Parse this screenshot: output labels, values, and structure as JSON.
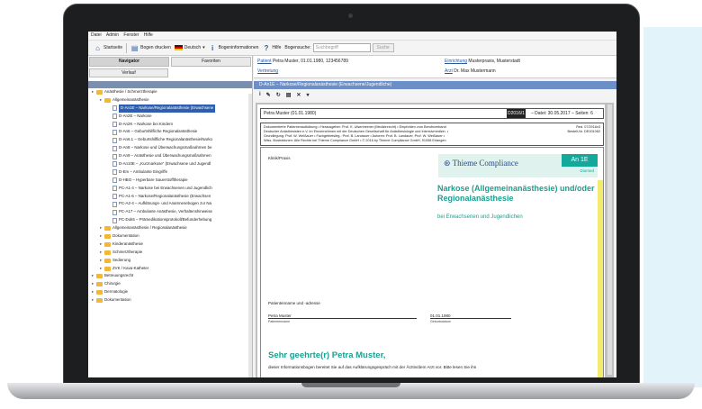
{
  "menubar": [
    "Datei",
    "Admin",
    "Fenster",
    "Hilfe"
  ],
  "toolbar": {
    "startseite": "Startseite",
    "bogen_drucken": "Bogen drucken",
    "sprache": "Deutsch",
    "bogeninfo": "Bogeninformationen",
    "hilfe": "Hilfe",
    "bogensuche_label": "Bogensuche:",
    "search_placeholder": "Suchbegriff",
    "go": "Suche"
  },
  "left": {
    "tabs": [
      "Navigator",
      "Favoriten"
    ],
    "tab2": "Verlauf",
    "tree": [
      {
        "text": "Anästhesie / Schmerztherapie",
        "type": "folder",
        "indent": 0
      },
      {
        "text": "Allgemeinanästhesie",
        "type": "folder",
        "indent": 1
      },
      {
        "text": "D-An1E – Narkose/Regionalanästhesie (Erwachsene",
        "type": "doc",
        "indent": 2,
        "selected": true
      },
      {
        "text": "D-An2E – Narkose",
        "type": "doc",
        "indent": 2
      },
      {
        "text": "D-An2K – Narkose bei Kindern",
        "type": "doc",
        "indent": 2
      },
      {
        "text": "D-An6 – Geburtshilfliche Regionalanästhesie",
        "type": "doc",
        "indent": 2
      },
      {
        "text": "D-An6.1 – Geburtshilfliche Regionalanästhesie/Narko",
        "type": "doc",
        "indent": 2
      },
      {
        "text": "D-An8 – Narkose und Überwachungsmaßnahmen be",
        "type": "doc",
        "indent": 2
      },
      {
        "text": "D-An9 – Anästhesie und Überwachungsmaßnahmen",
        "type": "doc",
        "indent": 2
      },
      {
        "text": "D-An10E – „Kurznarkose“ (Erwachsene und Jugendl",
        "type": "doc",
        "indent": 2
      },
      {
        "text": "D-Em – Ambulante Eingriffe",
        "type": "doc",
        "indent": 2
      },
      {
        "text": "D-HBO – Hyperbare Sauerstofftherapie",
        "type": "doc",
        "indent": 2
      },
      {
        "text": "PC-A1-4 – Narkose bei Erwachsenen und Jugendlich",
        "type": "doc",
        "indent": 2
      },
      {
        "text": "PC-A1-6 – Narkose/Regionalanästhesie (Erwachsen",
        "type": "doc",
        "indent": 2
      },
      {
        "text": "PC-A2-4 – Aufklärungs- und Anamnesebogen zur Na",
        "type": "doc",
        "indent": 2
      },
      {
        "text": "PC-A17 – Ambulante Anästhesie, Verhaltenshinweise",
        "type": "doc",
        "indent": 2
      },
      {
        "text": "PC-Dok5 – Prämedikationsprotokoll/Befunderhebung",
        "type": "doc",
        "indent": 2
      },
      {
        "text": "Allgemeinanästhesie / Regionalanästhesie",
        "type": "folder",
        "indent": 1
      },
      {
        "text": "Dokumentation",
        "type": "folder",
        "indent": 1
      },
      {
        "text": "Kinderanästhesie",
        "type": "folder",
        "indent": 1
      },
      {
        "text": "Schmerztherapie",
        "type": "folder",
        "indent": 1
      },
      {
        "text": "Sedierung",
        "type": "folder",
        "indent": 1
      },
      {
        "text": "ZVK / Kava-Katheter",
        "type": "folder",
        "indent": 1
      },
      {
        "text": "Betreuungsrecht",
        "type": "folder",
        "indent": 0
      },
      {
        "text": "Chirurgie",
        "type": "folder",
        "indent": 0
      },
      {
        "text": "Dermatologie",
        "type": "folder",
        "indent": 0
      },
      {
        "text": "Dokumentation",
        "type": "folder",
        "indent": 0
      }
    ]
  },
  "patient": {
    "label": "Patient",
    "value": "Petra Muster, 01.01.1980, 123456789",
    "einrichtung_label": "Einrichtung",
    "einrichtung_value": "Musterpraxis, Musterstadt",
    "vertretung_label": "Vertretung",
    "arzt_label": "Arzt",
    "arzt_value": "Dr. Max Mustermann"
  },
  "docbar": "D-An1E – Narkose/Regionalanästhesie (Erwachsene/Jugendliche)",
  "doc": {
    "patline_left": "Petra Muster (01.01.1980)",
    "patline_code": "D2016/1",
    "patline_right": "– Datei: 30.05.2017 – Seiten: 6",
    "box_lines": [
      "Dokumentierte Patientenaufklärung • Herausgeber: Prof. K. Ulsenheimer (Medizinrecht) • Empfohlen vom Berufsverband",
      "Deutscher Anästhesisten e.V. im Einvernehmen mit der Deutschen Gesellschaft für Anästhesiologie und Intensivmedizin. •",
      "Grundlegung: Prof. W. Weißauer • Fachgebietsltrg.: Prof. B. Landauer • Autoren: Prof. B. Landauer, Prof. W. Weißauer •",
      "Wiss. Illustrationen: Alle Rechte bei Thieme Compliance GmbH • © 2016 by Thieme Compliance GmbH, 91058 Erlangen"
    ],
    "red": "Red. 07/2016v3",
    "bestell": "Bestell-Nr. DE001062",
    "klinik": "Klinik/Praxis",
    "logo": "Thieme Compliance",
    "code": "An 1E",
    "diomed": "Diomed",
    "title_line1": "Narkose (Allgemeinanästhesie) und/oder",
    "title_line2": "Regionalanästhesie",
    "subtitle": "bei Erwachsenen und Jugendlichen",
    "patientenname_label": "Patientenname und -adresse",
    "name_value": "Petra Muster",
    "name_caption": "Patientenname",
    "dob_value": "01.01.1980",
    "dob_caption": "Geburtsdatum",
    "greeting": "Sehr geehrte(r) Petra Muster,",
    "body": "dieser Informationsbogen bereitet Sie auf das Aufklärungsgespräch mit der Ärztin/dem Arzt vor. Bitte lesen Sie ihn"
  }
}
